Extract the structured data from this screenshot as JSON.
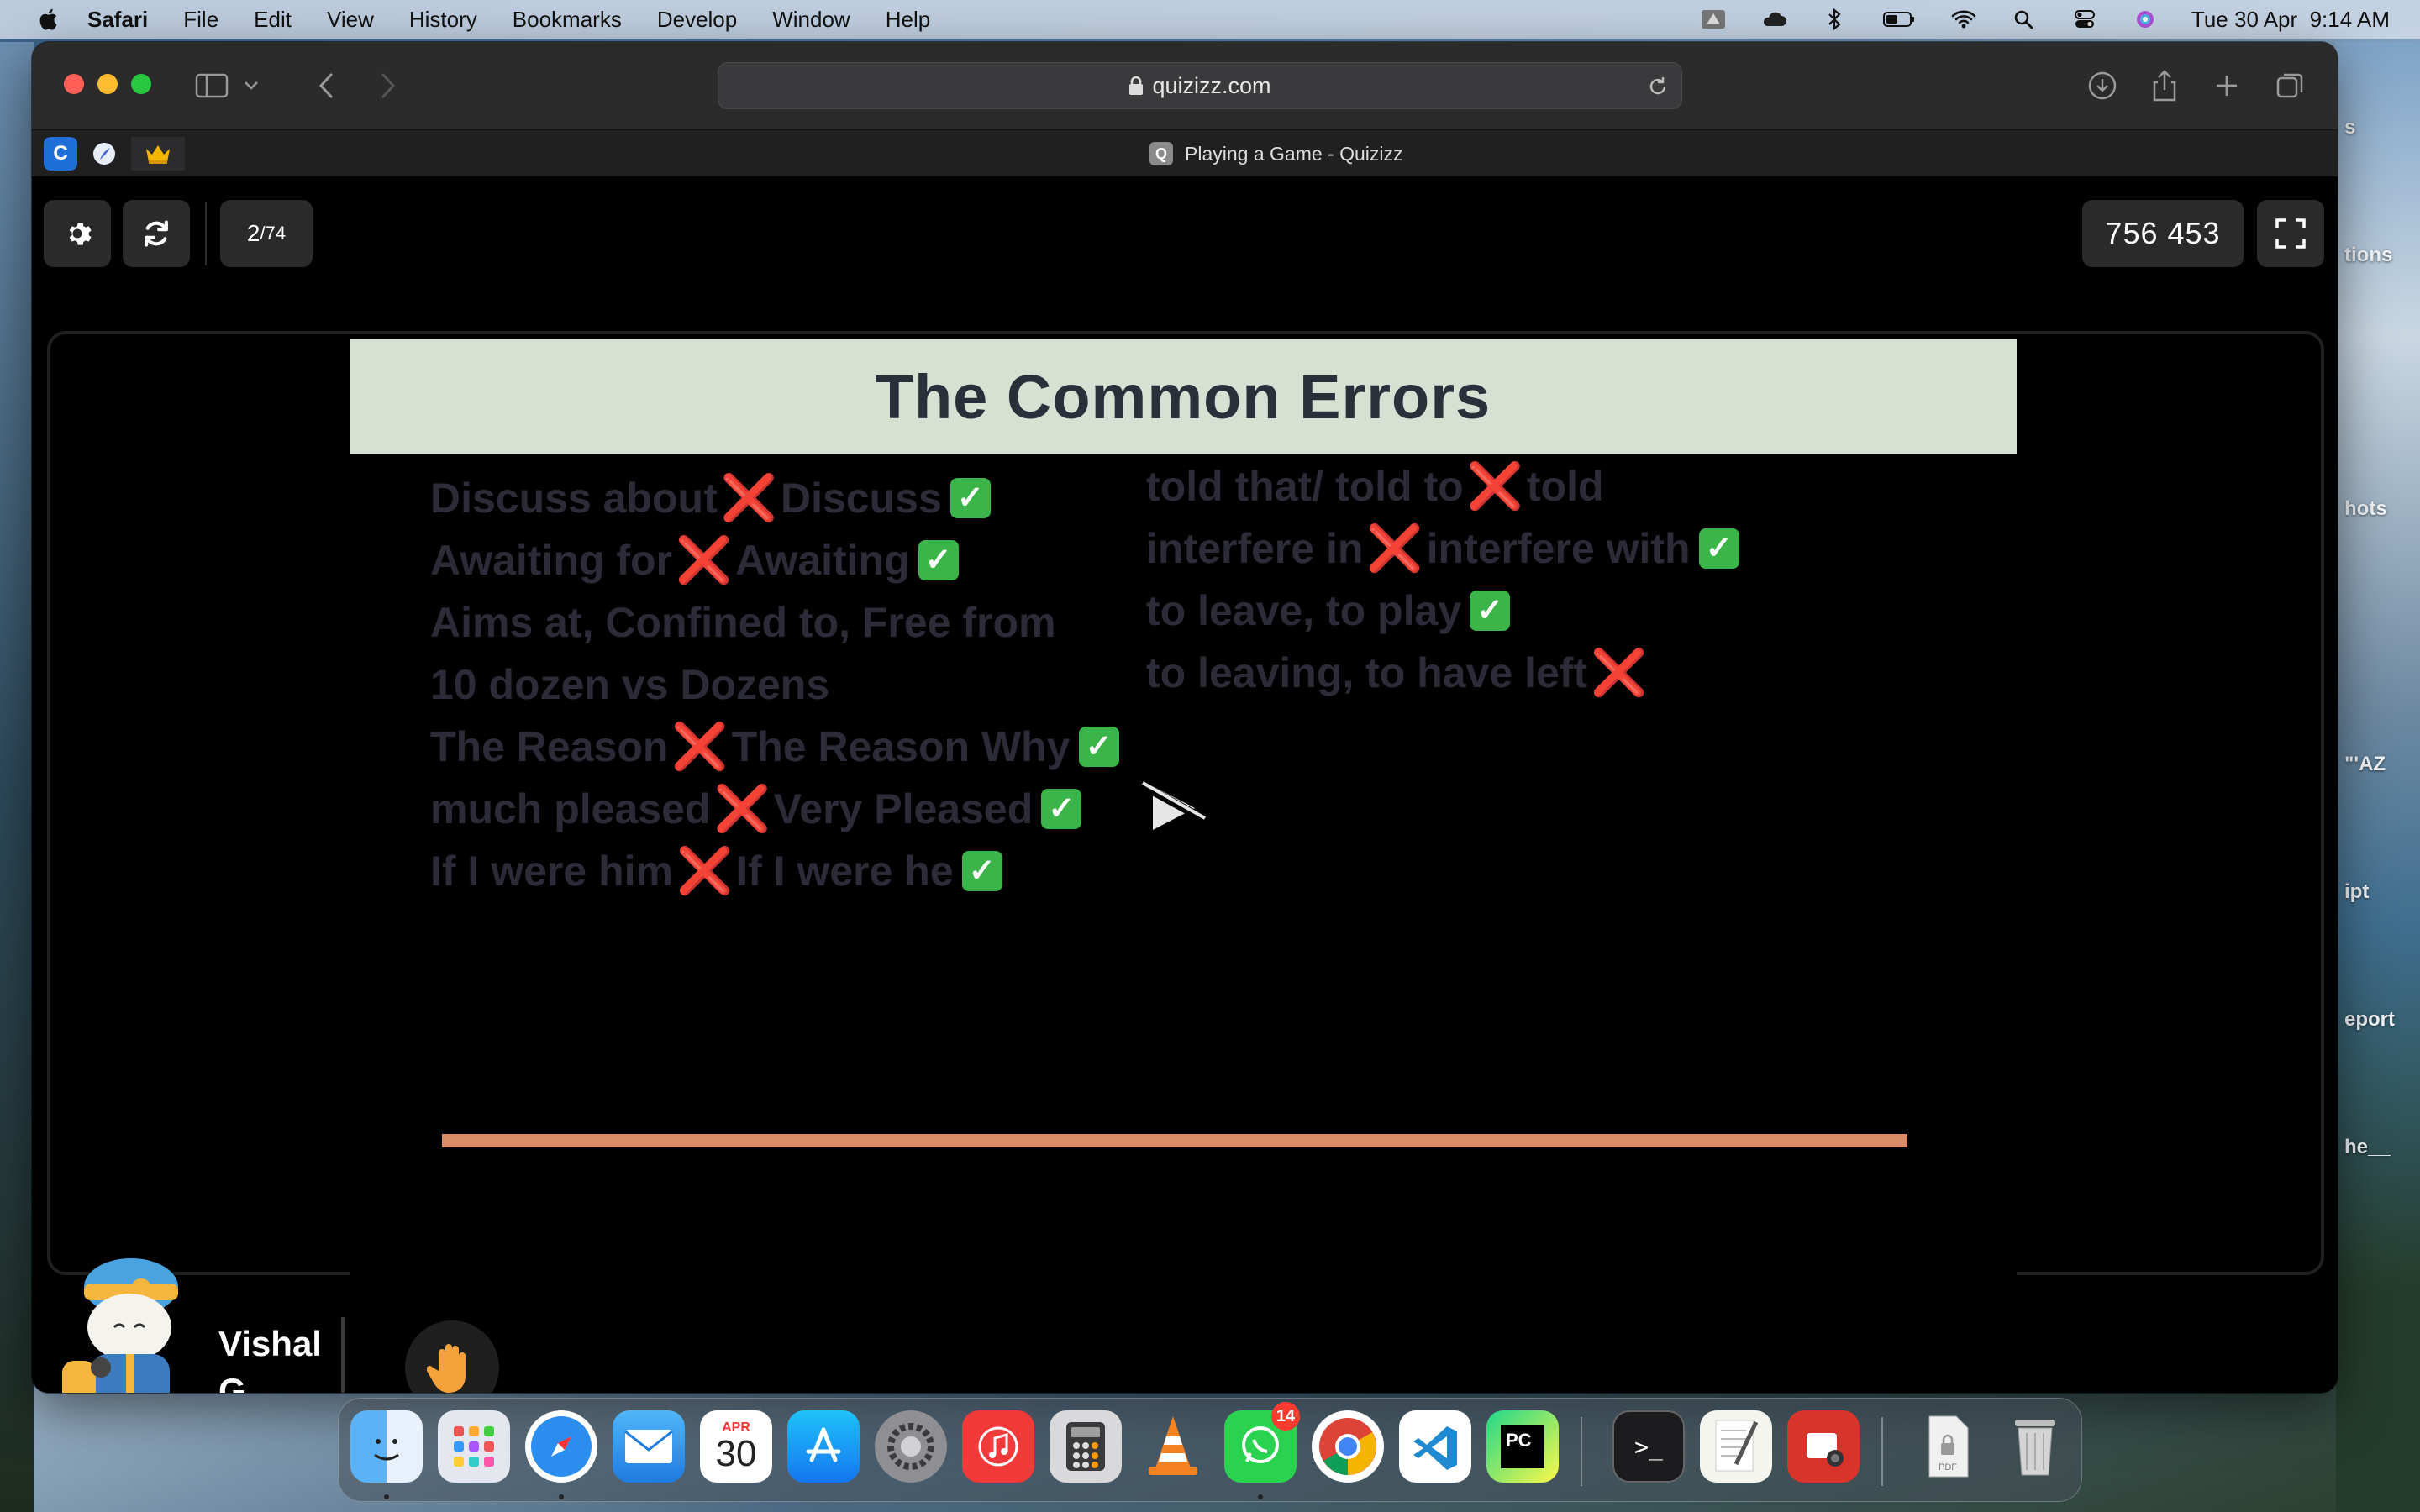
{
  "menubar": {
    "app_name": "Safari",
    "items": [
      "File",
      "Edit",
      "View",
      "History",
      "Bookmarks",
      "Develop",
      "Window",
      "Help"
    ],
    "datetime": "Tue 30 Apr  9:14 AM"
  },
  "desktop": {
    "labels": [
      "s",
      "tions",
      "hots",
      "\"'AZ",
      "ipt",
      "eport",
      "he__"
    ]
  },
  "browser": {
    "url": "quizizz.com",
    "tab_title": "Playing a Game - Quizizz",
    "tab_favicon_letter": "Q",
    "pinned_tabs": [
      "C",
      "feather",
      "crown"
    ]
  },
  "game": {
    "question_current": "2",
    "question_total": "/74",
    "score": "756 453",
    "player_name": "Vishal G",
    "slide": {
      "title": "The Common Errors",
      "left_column": [
        {
          "text": "Discuss about ",
          "mark": "x",
          "after": "Discuss ",
          "end": "check"
        },
        {
          "text": "Awaiting for ",
          "mark": "x",
          "after": "Awaiting ",
          "end": "check"
        },
        {
          "text": "Aims at, Confined to, Free from",
          "mark": "",
          "after": "",
          "end": ""
        },
        {
          "text": "10 dozen vs Dozens",
          "mark": "",
          "after": "",
          "end": ""
        },
        {
          "text": "The Reason ",
          "mark": "x",
          "after": " The Reason Why ",
          "end": "check"
        },
        {
          "text": "much pleased ",
          "mark": "x",
          "after": " Very Pleased ",
          "end": "check"
        },
        {
          "text": "If I were him ",
          "mark": "x",
          "after": " If I were he ",
          "end": "check"
        }
      ],
      "right_column": [
        {
          "text": "told that/ told to ",
          "mark": "x",
          "after": "told",
          "end": ""
        },
        {
          "text": "interfere in ",
          "mark": "x",
          "after": " interfere with ",
          "end": "check"
        },
        {
          "text": "to leave, to play ",
          "mark": "",
          "after": "",
          "end": "check"
        },
        {
          "text": "to leaving, to have left ",
          "mark": "x",
          "after": "",
          "end": ""
        }
      ]
    }
  },
  "dock": {
    "calendar_month": "APR",
    "calendar_day": "30",
    "whatsapp_badge": "14",
    "pycharm_label": "PC",
    "pdf_label": "PDF"
  },
  "colors": {
    "slide_header_bg": "#d6e1d4",
    "slide_text": "#2c2c38",
    "progress_bar": "#d98c67",
    "x_mark": "#e0201b",
    "check_mark": "#3bb54a"
  }
}
